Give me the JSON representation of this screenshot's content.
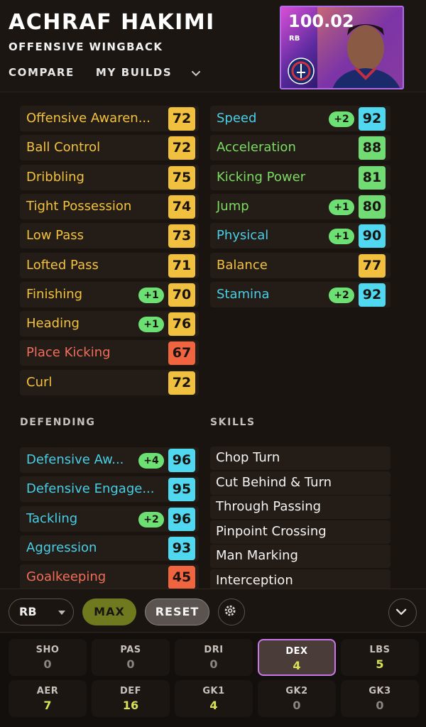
{
  "header": {
    "name": "ACHRAF HAKIMI",
    "playstyle": "OFFENSIVE WINGBACK",
    "nav": [
      "COMPARE",
      "MY BUILDS"
    ]
  },
  "card": {
    "rating": "100.02",
    "position": "RB"
  },
  "attacking": [
    {
      "label": "Offensive Awaren...",
      "value": "72",
      "boost": "",
      "color": "yellow"
    },
    {
      "label": "Ball Control",
      "value": "72",
      "boost": "",
      "color": "yellow"
    },
    {
      "label": "Dribbling",
      "value": "75",
      "boost": "",
      "color": "yellow"
    },
    {
      "label": "Tight Possession",
      "value": "74",
      "boost": "",
      "color": "yellow"
    },
    {
      "label": "Low Pass",
      "value": "73",
      "boost": "",
      "color": "yellow"
    },
    {
      "label": "Lofted Pass",
      "value": "71",
      "boost": "",
      "color": "yellow"
    },
    {
      "label": "Finishing",
      "value": "70",
      "boost": "+1",
      "color": "yellow"
    },
    {
      "label": "Heading",
      "value": "76",
      "boost": "+1",
      "color": "yellow"
    },
    {
      "label": "Place Kicking",
      "value": "67",
      "boost": "",
      "color": "red"
    },
    {
      "label": "Curl",
      "value": "72",
      "boost": "",
      "color": "yellow"
    }
  ],
  "physical": [
    {
      "label": "Speed",
      "value": "92",
      "boost": "+2",
      "color": "cyan"
    },
    {
      "label": "Acceleration",
      "value": "88",
      "boost": "",
      "color": "green"
    },
    {
      "label": "Kicking Power",
      "value": "81",
      "boost": "",
      "color": "green"
    },
    {
      "label": "Jump",
      "value": "80",
      "boost": "+1",
      "color": "green"
    },
    {
      "label": "Physical",
      "value": "90",
      "boost": "+1",
      "color": "cyan"
    },
    {
      "label": "Balance",
      "value": "77",
      "boost": "",
      "color": "yellow"
    },
    {
      "label": "Stamina",
      "value": "92",
      "boost": "+2",
      "color": "cyan"
    }
  ],
  "defending_title": "DEFENDING",
  "defending": [
    {
      "label": "Defensive Aw...",
      "value": "96",
      "boost": "+4",
      "color": "cyan"
    },
    {
      "label": "Defensive Engage...",
      "value": "95",
      "boost": "",
      "color": "cyan"
    },
    {
      "label": "Tackling",
      "value": "96",
      "boost": "+2",
      "color": "cyan"
    },
    {
      "label": "Aggression",
      "value": "93",
      "boost": "",
      "color": "cyan"
    },
    {
      "label": "Goalkeeping",
      "value": "45",
      "boost": "",
      "color": "red"
    }
  ],
  "skills_title": "SKILLS",
  "skills": [
    "Chop Turn",
    "Cut Behind & Turn",
    "Through Passing",
    "Pinpoint Crossing",
    "Man Marking",
    "Interception"
  ],
  "toolbar": {
    "position": "RB",
    "max_label": "MAX",
    "reset_label": "RESET"
  },
  "points": [
    {
      "name": "SHO",
      "value": "0",
      "active": false
    },
    {
      "name": "PAS",
      "value": "0",
      "active": false
    },
    {
      "name": "DRI",
      "value": "0",
      "active": false
    },
    {
      "name": "DEX",
      "value": "4",
      "active": true
    },
    {
      "name": "LBS",
      "value": "5",
      "active": false
    },
    {
      "name": "AER",
      "value": "7",
      "active": false
    },
    {
      "name": "DEF",
      "value": "16",
      "active": false
    },
    {
      "name": "GK1",
      "value": "4",
      "active": false
    },
    {
      "name": "GK2",
      "value": "0",
      "active": false
    },
    {
      "name": "GK3",
      "value": "0",
      "active": false
    }
  ]
}
